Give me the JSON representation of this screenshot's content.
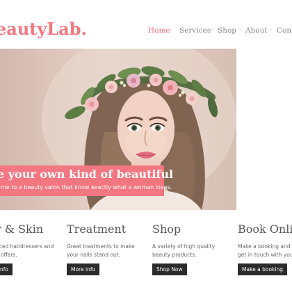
{
  "header": {
    "logo": "eautyLab.",
    "nav": [
      {
        "label": "Home",
        "active": true
      },
      {
        "label": "Services",
        "active": false
      },
      {
        "label": "Shop",
        "active": false
      },
      {
        "label": "About",
        "active": false
      },
      {
        "label": "Conta",
        "active": false
      }
    ],
    "separator": "·"
  },
  "hero": {
    "title": "e your own kind of beautiful",
    "subtitle": "me to a beauty salon that know exactly what a woman loves."
  },
  "columns": [
    {
      "title": "r & Skin",
      "lines": [
        "nced hairdressers and",
        "e offers."
      ],
      "button": "nfo"
    },
    {
      "title": "Treatment",
      "lines": [
        "Great treatments to make",
        "your nails stand out."
      ],
      "button": "More info"
    },
    {
      "title": "Shop",
      "lines": [
        "A variety of high quality",
        "beauty products."
      ],
      "button": "Shop Now"
    },
    {
      "title": "Book Online",
      "lines": [
        "Make a booking and we",
        "get in touch with you."
      ],
      "button": "Make a booking"
    }
  ],
  "colors": {
    "accent": "#f27781",
    "button": "#2b2b2b",
    "nav_text": "#8a8a8a"
  }
}
